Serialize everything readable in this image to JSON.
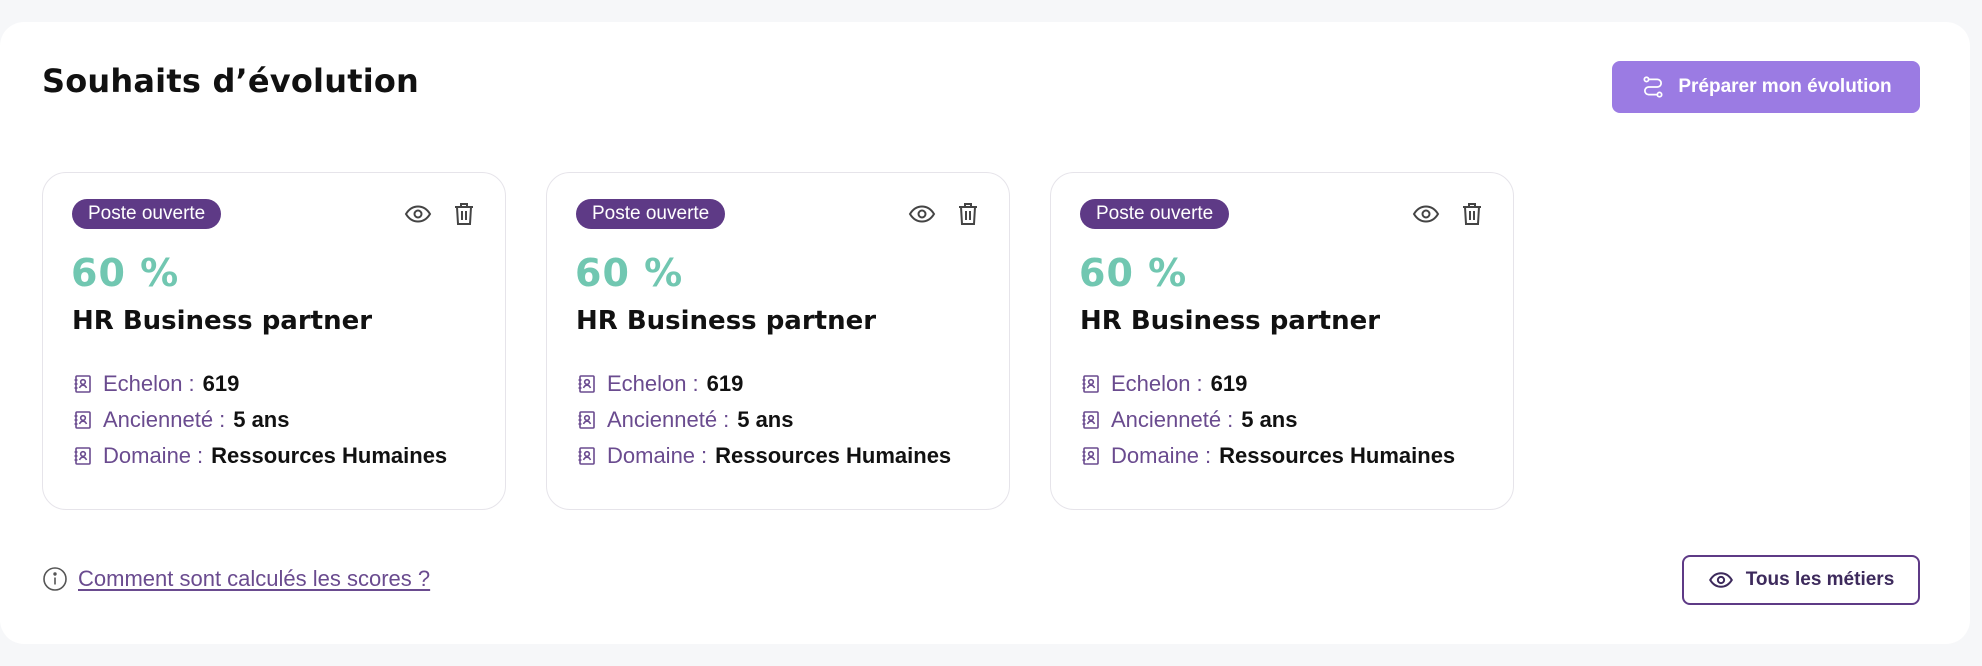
{
  "section": {
    "title": "Souhaits d’évolution",
    "prepare_button_label": "Préparer mon évolution"
  },
  "cards": [
    {
      "badge": "Poste ouverte",
      "score": "60 %",
      "title": "HR Business partner",
      "fields": [
        {
          "label": "Echelon",
          "value": "619"
        },
        {
          "label": "Ancienneté",
          "value": "5 ans"
        },
        {
          "label": "Domaine",
          "value": "Ressources Humaines"
        }
      ]
    },
    {
      "badge": "Poste ouverte",
      "score": "60 %",
      "title": "HR Business partner",
      "fields": [
        {
          "label": "Echelon",
          "value": "619"
        },
        {
          "label": "Ancienneté",
          "value": "5 ans"
        },
        {
          "label": "Domaine",
          "value": "Ressources Humaines"
        }
      ]
    },
    {
      "badge": "Poste ouverte",
      "score": "60 %",
      "title": "HR Business partner",
      "fields": [
        {
          "label": "Echelon",
          "value": "619"
        },
        {
          "label": "Ancienneté",
          "value": "5 ans"
        },
        {
          "label": "Domaine",
          "value": "Ressources Humaines"
        }
      ]
    }
  ],
  "footer": {
    "help_link": "Comment sont calculés les scores ?",
    "all_jobs_button_label": "Tous les métiers"
  },
  "icons": {
    "prepare": "route-icon",
    "view": "eye-icon",
    "delete": "trash-icon",
    "field": "contact-book-icon",
    "help": "info-icon"
  },
  "colors": {
    "primary": "#9b7be3",
    "badge": "#5e3a86",
    "score": "#71c7b1",
    "label": "#6a4b8f"
  }
}
